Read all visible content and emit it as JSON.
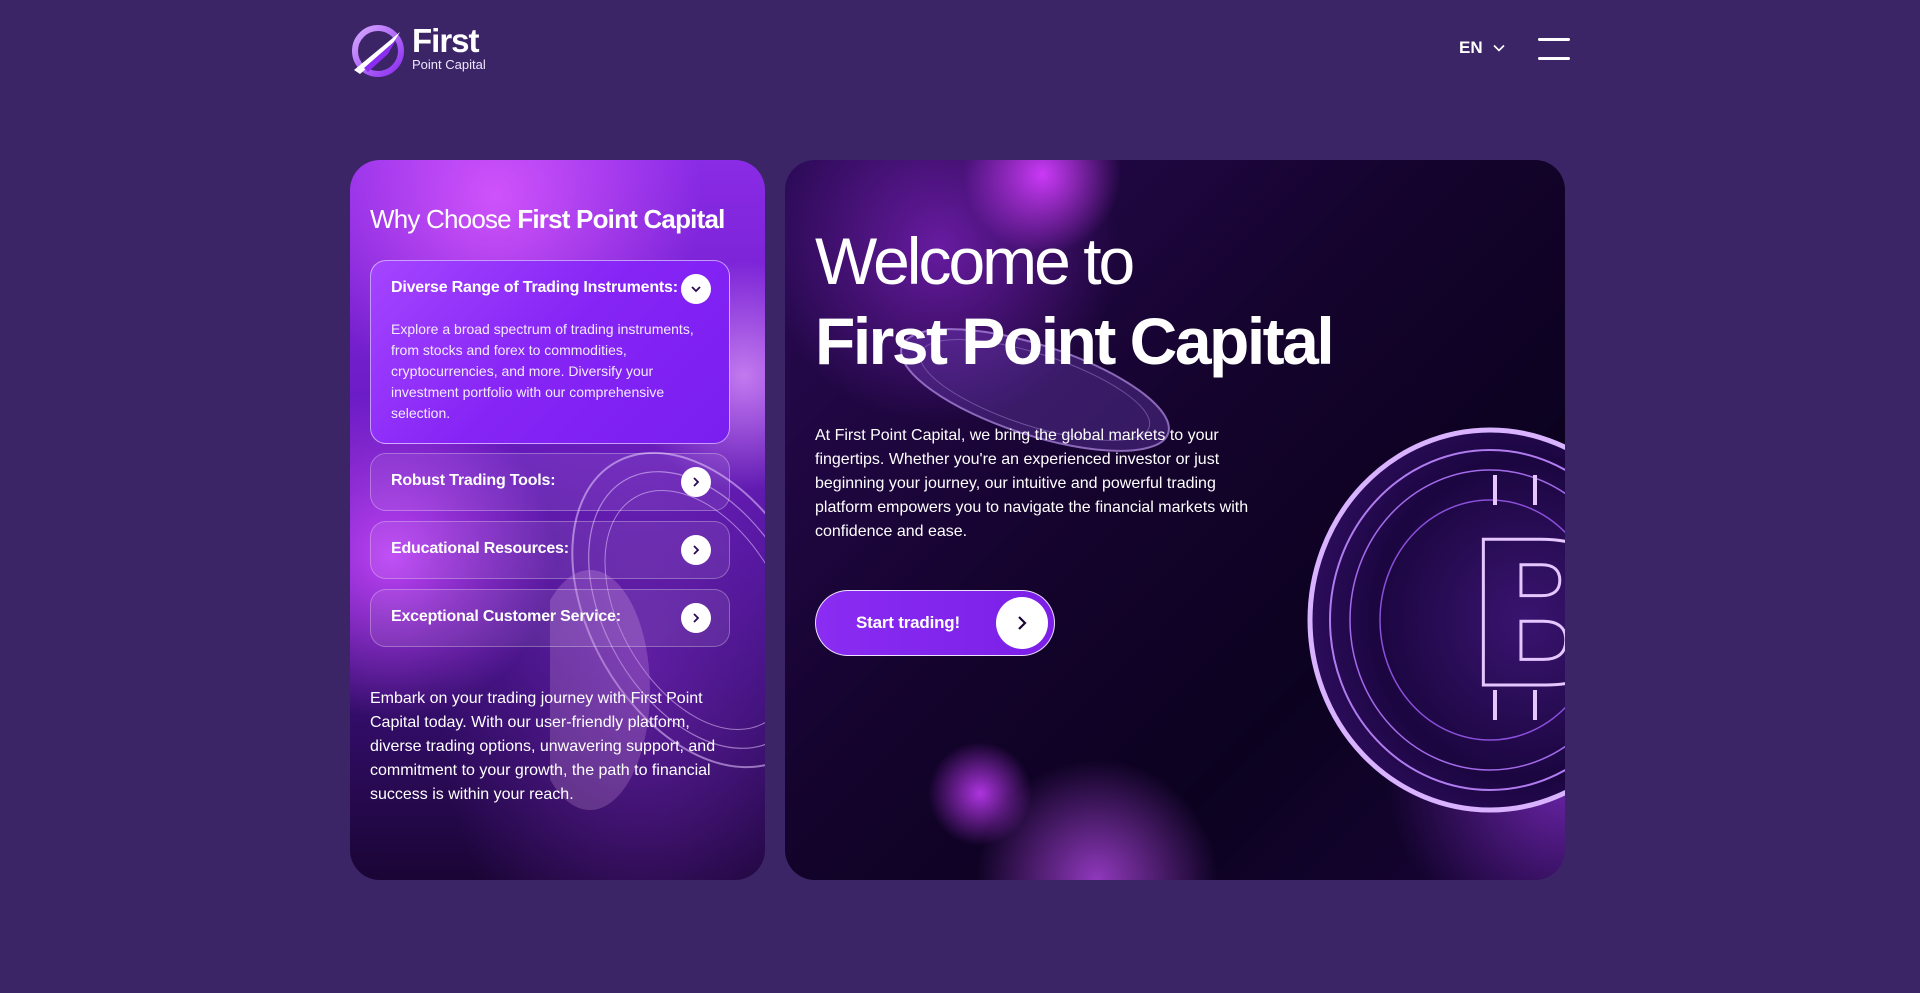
{
  "header": {
    "logo_title": "First",
    "logo_subtitle": "Point Capital",
    "language": "EN"
  },
  "why": {
    "title_light": "Why Choose",
    "title_bold": "First Point Capital",
    "items": [
      {
        "label": "Diverse Range of Trading Instruments:",
        "body": "Explore a broad spectrum of trading instruments, from stocks and forex to commodities, cryptocurrencies, and more. Diversify your investment portfolio with our comprehensive selection."
      },
      {
        "label": "Robust Trading Tools:"
      },
      {
        "label": "Educational Resources:"
      },
      {
        "label": "Exceptional Customer Service:"
      }
    ],
    "footer_text": "Embark on your trading journey with First Point Capital today. With our user-friendly platform, diverse trading options, unwavering support, and commitment to your growth, the path to financial success is within your reach."
  },
  "hero": {
    "welcome_line1": "Welcome to",
    "welcome_line2": "First Point Capital",
    "description": "At First Point Capital, we bring the global markets to your fingertips. Whether you're an experienced investor or just beginning your journey, our intuitive and powerful trading platform empowers you to navigate the financial markets with confidence and ease.",
    "cta_label": "Start trading!"
  },
  "colors": {
    "background": "#3b2566",
    "accent": "#8a2cf2",
    "card_dark": "#14032c"
  },
  "icons": {
    "logo": "logo-icon",
    "language": "chevron-down-icon",
    "menu": "hamburger-menu-icon",
    "accordion_open": "chevron-down-icon",
    "accordion_closed": "chevron-right-icon",
    "cta": "chevron-right-icon"
  }
}
